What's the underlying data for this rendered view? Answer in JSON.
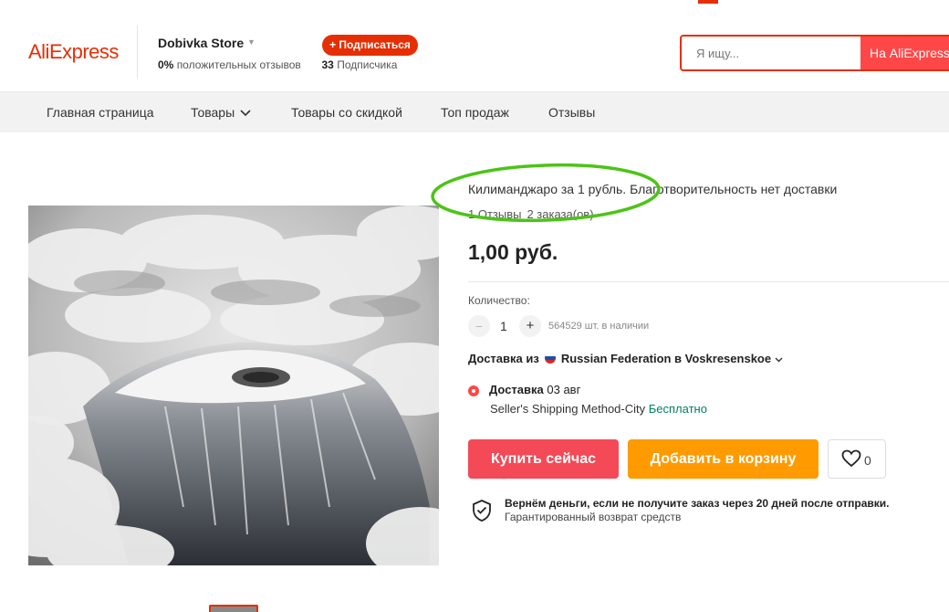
{
  "header": {
    "logo": "AliExpress",
    "store_name": "Dobivka Store",
    "rating_value": "0%",
    "rating_label": "положительных отзывов",
    "followers_value": "33",
    "followers_label": "Подписчика",
    "subscribe_label": "+ Подписаться",
    "search_placeholder": "Я ищу...",
    "search_button": "На AliExpress"
  },
  "nav": {
    "items": [
      {
        "label": "Главная страница"
      },
      {
        "label": "Товары",
        "has_dropdown": true
      },
      {
        "label": "Товары со скидкой"
      },
      {
        "label": "Топ продаж"
      },
      {
        "label": "Отзывы"
      }
    ]
  },
  "product": {
    "title": "Килиманджаро за 1 рубль. Благотворительность нет доставки",
    "reviews": "1 Отзывы",
    "orders": "2 заказа(ов)",
    "price": "1,00 руб.",
    "quantity_label": "Количество:",
    "quantity_minus": "−",
    "quantity_value": "1",
    "quantity_plus": "+",
    "stock": "564529 шт. в наличии",
    "ship_from_label": "Доставка из",
    "ship_from_value": "Russian Federation в Voskresenskoe",
    "delivery_label": "Доставка",
    "delivery_date": "03 авг",
    "shipping_method": "Seller's Shipping Method-City",
    "shipping_price": "Бесплатно",
    "buy_now": "Купить сейчас",
    "add_to_cart": "Добавить в корзину",
    "wishlist_count": "0",
    "guarantee_title": "Вернём деньги, если не получите заказ через 20 дней после отправки.",
    "guarantee_subtitle": "Гарантированный возврат средств"
  },
  "colors": {
    "brand": "#e62e04",
    "buy_button": "#f44956",
    "cart_button": "#ff9a00",
    "free_shipping": "#008060",
    "annotation": "#4cc417"
  },
  "icons": [
    "chevron-down-icon",
    "russia-flag-icon",
    "heart-icon",
    "shield-check-icon"
  ]
}
